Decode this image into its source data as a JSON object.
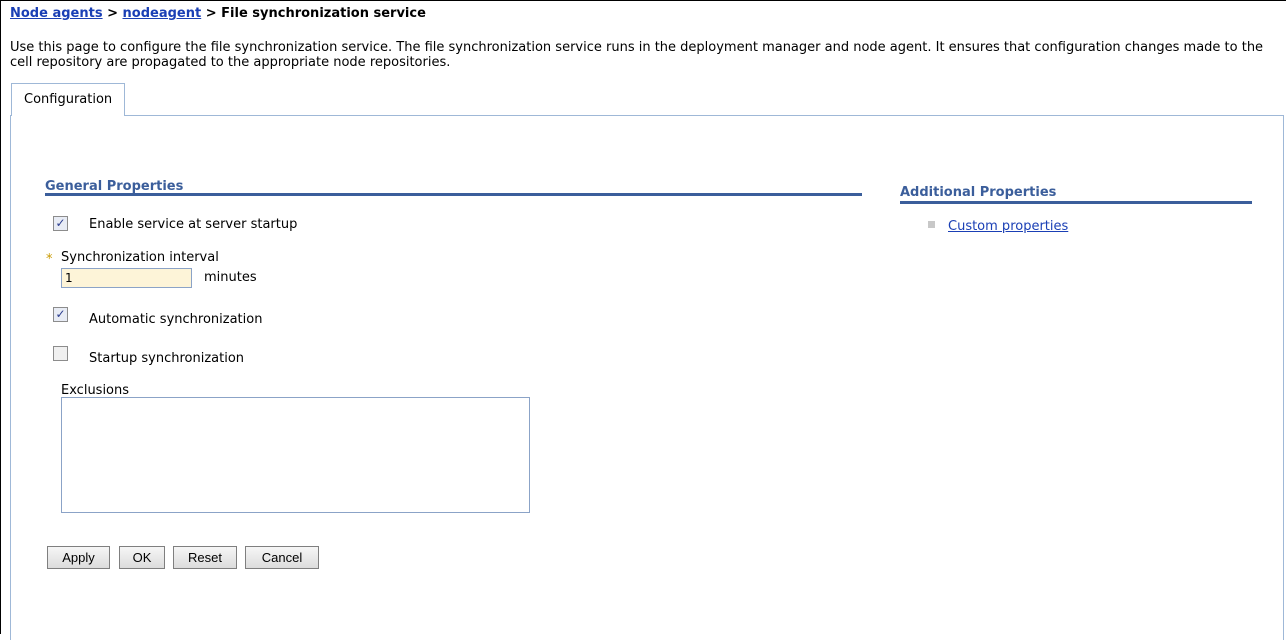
{
  "breadcrumb": {
    "items": [
      "Node agents",
      "nodeagent"
    ],
    "separator": " > ",
    "current": "File synchronization service"
  },
  "description": "Use this page to configure the file synchronization service. The file synchronization service runs in the deployment manager and node agent. It ensures that configuration changes made to the cell repository are propagated to the appropriate node repositories.",
  "tabs": [
    {
      "label": "Configuration",
      "active": true
    }
  ],
  "general": {
    "title": "General Properties",
    "enable_service": {
      "label": "Enable service at server startup",
      "checked": true
    },
    "interval": {
      "required_marker": "*",
      "label": "Synchronization interval",
      "value": "1",
      "unit": "minutes"
    },
    "auto_sync": {
      "label": "Automatic synchronization",
      "checked": true
    },
    "startup_sync": {
      "label": "Startup synchronization",
      "checked": false
    },
    "exclusions": {
      "label": "Exclusions",
      "value": ""
    }
  },
  "buttons": {
    "apply": "Apply",
    "ok": "OK",
    "reset": "Reset",
    "cancel": "Cancel"
  },
  "additional": {
    "title": "Additional Properties",
    "links": [
      "Custom properties"
    ]
  },
  "colors": {
    "link": "#1a3fb5",
    "section": "#3b5e9b",
    "tab_border": "#9fb8d7",
    "required": "#c99a00"
  }
}
